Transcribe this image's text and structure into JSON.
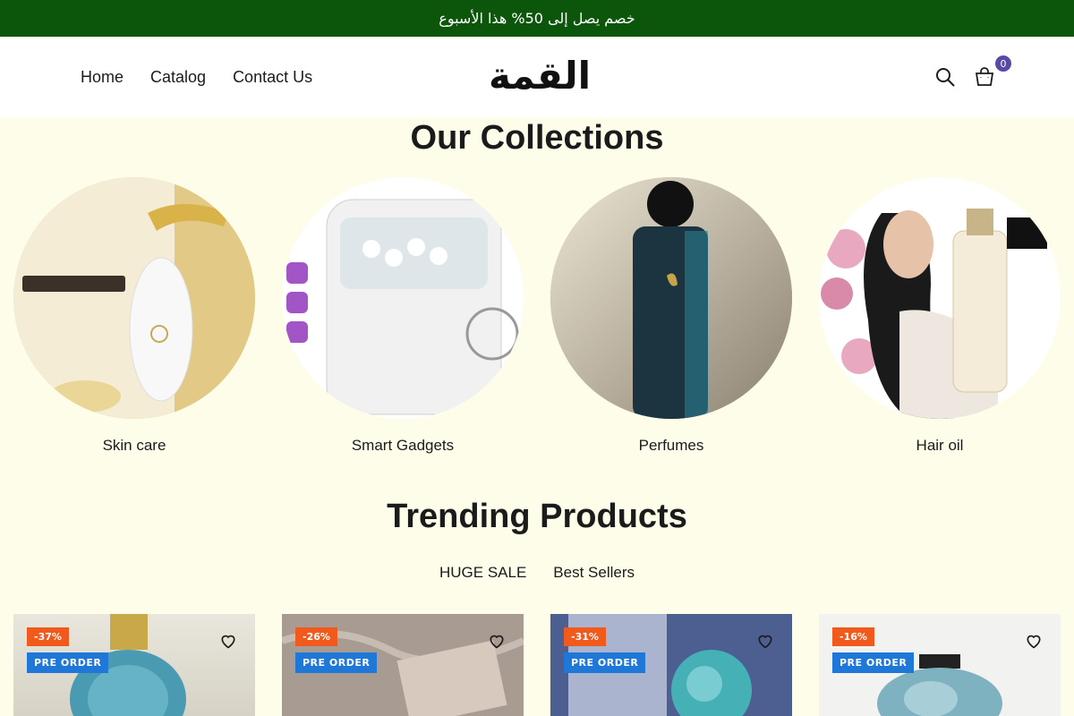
{
  "announcement": "خصم يصل إلى 50% هذا الأسبوع",
  "nav": {
    "home": "Home",
    "catalog": "Catalog",
    "contact": "Contact Us"
  },
  "logo": {
    "text": "القمة"
  },
  "cart": {
    "count": "0"
  },
  "icons": {
    "search": "search-icon",
    "cart": "cart-icon",
    "wishlist": "heart-icon"
  },
  "collections": {
    "title": "Our Collections",
    "items": [
      {
        "label": "Skin care"
      },
      {
        "label": "Smart Gadgets"
      },
      {
        "label": "Perfumes"
      },
      {
        "label": "Hair oil"
      }
    ]
  },
  "trending": {
    "title": "Trending Products",
    "tabs": [
      "HUGE SALE",
      "Best Sellers"
    ]
  },
  "products": [
    {
      "discount": "-37%",
      "preorder": "PRE ORDER"
    },
    {
      "discount": "-26%",
      "preorder": "PRE ORDER"
    },
    {
      "discount": "-31%",
      "preorder": "PRE ORDER"
    },
    {
      "discount": "-16%",
      "preorder": "PRE ORDER"
    }
  ],
  "colors": {
    "announce_bg": "#0b560b",
    "page_bg": "#fdfde9",
    "sale_badge": "#f05a1d",
    "preorder_badge": "#1f78d8",
    "cart_badge": "#5b4aa5"
  }
}
